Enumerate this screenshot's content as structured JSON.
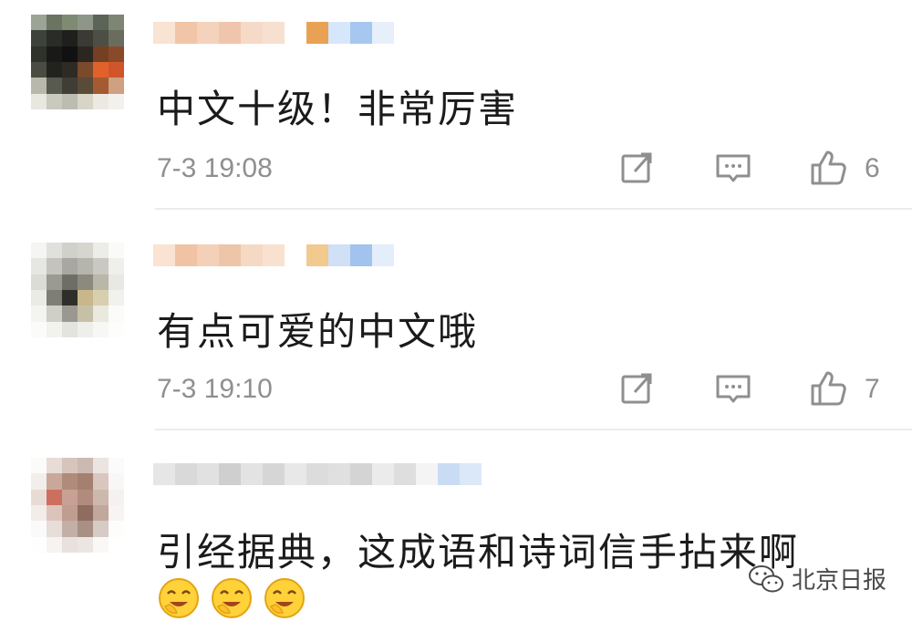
{
  "comments": [
    {
      "text": "中文十级！非常厉害",
      "time": "7-3 19:08",
      "likes": "6",
      "avatar_colors": [
        "#9aa596",
        "#6b7363",
        "#7f8a73",
        "#8e9787",
        "#5c6357",
        "#7d8673",
        "#3d423b",
        "#2a2c28",
        "#1f201d",
        "#3b3a34",
        "#4d4f44",
        "#6a6d5e",
        "#2f312b",
        "#191a17",
        "#111111",
        "#2b261f",
        "#744024",
        "#8a4a2a",
        "#4a4b42",
        "#23231e",
        "#2e2a24",
        "#7a4a2a",
        "#e0622a",
        "#d0552a",
        "#b8b9ab",
        "#595a4f",
        "#3f3d35",
        "#5a4a38",
        "#a55a30",
        "#cfa082",
        "#e8e7e0",
        "#c9c9be",
        "#bcbcb0",
        "#d8d4c8",
        "#ece9e3",
        "#f3f1ec"
      ],
      "username_colors": [
        "#f9e3d3",
        "#f1c5a8",
        "#f4d2bb",
        "#efc6ab",
        "#f6dac8",
        "#f7e0cf",
        "#ffffff",
        "#e9a253",
        "#d7e7fb",
        "#a6c7f0",
        "#e6effa"
      ]
    },
    {
      "text": "有点可爱的中文哦",
      "time": "7-3 19:10",
      "likes": "7",
      "avatar_colors": [
        "#f5f5f3",
        "#e0e0dc",
        "#d1d1cb",
        "#d6d6cf",
        "#ecece8",
        "#fafaf8",
        "#e6e6e2",
        "#c4c4bd",
        "#a8a8a0",
        "#b5b5ad",
        "#c9c9c2",
        "#efefeb",
        "#dcdcd6",
        "#9a9a91",
        "#6e6e66",
        "#8c8a7d",
        "#b9b7a8",
        "#e8e8e4",
        "#eaeae6",
        "#7f7e74",
        "#2f2e2a",
        "#c7b78a",
        "#d8cfae",
        "#f1f1ed",
        "#f4f4f1",
        "#cfcec7",
        "#9a9890",
        "#c6c1a6",
        "#ebe9df",
        "#fbfbf9",
        "#fbfbfa",
        "#f2f2ef",
        "#e4e4df",
        "#eeeeea",
        "#f7f7f5",
        "#fdfdfc"
      ],
      "username_colors": [
        "#fae3d2",
        "#f0c3a4",
        "#f3d0b7",
        "#eec5a8",
        "#f5d9c5",
        "#f8e1cf",
        "#ffffff",
        "#f2c98f",
        "#cfe0f7",
        "#a1c3ee",
        "#e4eefa"
      ]
    },
    {
      "text": "引经据典，这成语和诗词信手拈来啊",
      "avatar_colors": [
        "#fbfbfa",
        "#e7dcd6",
        "#d7c5bc",
        "#cbbab1",
        "#ebe4e0",
        "#fcfbfb",
        "#f2eeec",
        "#c9a89a",
        "#b08a7b",
        "#a57f70",
        "#d9c7bf",
        "#f9f7f6",
        "#e8dbd5",
        "#cd6f5e",
        "#c8a194",
        "#b18c7e",
        "#cdb8ae",
        "#f5f1ef",
        "#f3edea",
        "#dcc4ba",
        "#bf9d90",
        "#8e6c60",
        "#c1a79c",
        "#f7f4f3",
        "#fbfafa",
        "#e7ded9",
        "#c2b0a8",
        "#a98f84",
        "#d7cbc5",
        "#fdfdfc",
        "#fefefe",
        "#f6f3f1",
        "#e8e1dd",
        "#ece6e3",
        "#faf8f7",
        "#ffffff"
      ],
      "username_colors": [
        "#e6e6e6",
        "#d9d9d9",
        "#e1e1e1",
        "#cfcfcf",
        "#e3e3e3",
        "#d6d6d6",
        "#e8e8e8",
        "#dcdcdc",
        "#e0e0e0",
        "#d4d4d4",
        "#ebebeb",
        "#dedede",
        "#f4f4f4",
        "#c9dcf3",
        "#dbe8f8"
      ]
    }
  ],
  "watermark": {
    "text": "北京日报"
  },
  "icons": {
    "share": "share-icon",
    "comment": "comment-icon",
    "like": "like-icon",
    "emoji": "grin-emoji-icon",
    "wechat": "wechat-icon"
  }
}
